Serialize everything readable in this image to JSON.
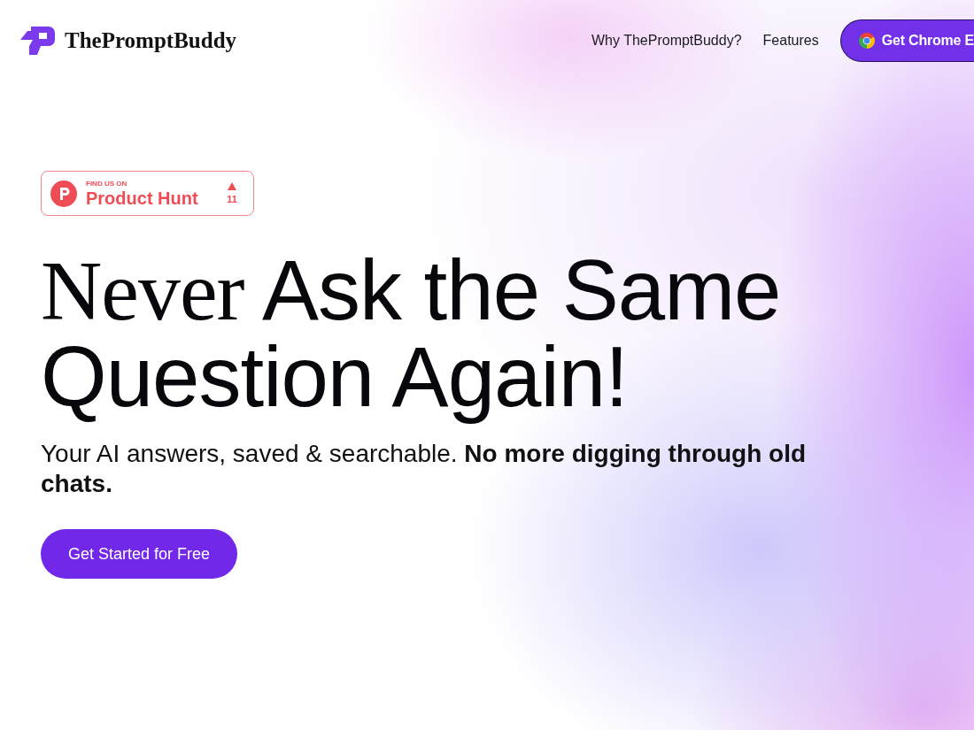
{
  "header": {
    "logo": {
      "name": "ThePromptBuddy"
    },
    "nav_links": [
      "Why ThePromptBuddy?",
      "Features"
    ],
    "cta_button": "Get Chrome E"
  },
  "hero": {
    "product_hunt_badge": {
      "caption": "FIND US ON",
      "name": "Product Hunt",
      "upvotes": "11"
    },
    "headline": {
      "accent": "Never",
      "rest": "Ask the Same Question Again!"
    },
    "subtitle": "Your AI answers, saved & searchable. **No more digging through old chats.**",
    "primary_button": "Get Started for Free"
  }
}
